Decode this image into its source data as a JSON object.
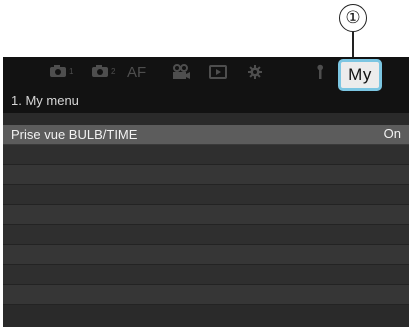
{
  "callout": {
    "number": "①"
  },
  "tabs": {
    "shooting1": {
      "icon": "camera-icon",
      "sub": "1"
    },
    "shooting2": {
      "icon": "camera-icon",
      "sub": "2"
    },
    "af": {
      "label": "AF"
    },
    "video": {
      "icon": "video-camera-icon"
    },
    "playback": {
      "icon": "playback-icon"
    },
    "settings": {
      "icon": "gear-icon"
    },
    "custom": {
      "icon": "wrench-icon"
    },
    "my": {
      "label": "My",
      "active": true
    }
  },
  "colors": {
    "active_tab_border": "#7cc6e2",
    "selected_row": "#5c5c5c",
    "screen_bg": "#2a2a2a"
  },
  "page_title": "1. My menu",
  "menu": {
    "items": [
      {
        "label": "Prise vue BULB/TIME",
        "value": "On",
        "selected": true
      },
      {
        "label": "",
        "value": ""
      },
      {
        "label": "",
        "value": ""
      },
      {
        "label": "",
        "value": ""
      },
      {
        "label": "",
        "value": ""
      },
      {
        "label": "",
        "value": ""
      },
      {
        "label": "",
        "value": ""
      },
      {
        "label": "",
        "value": ""
      },
      {
        "label": "",
        "value": ""
      }
    ]
  }
}
